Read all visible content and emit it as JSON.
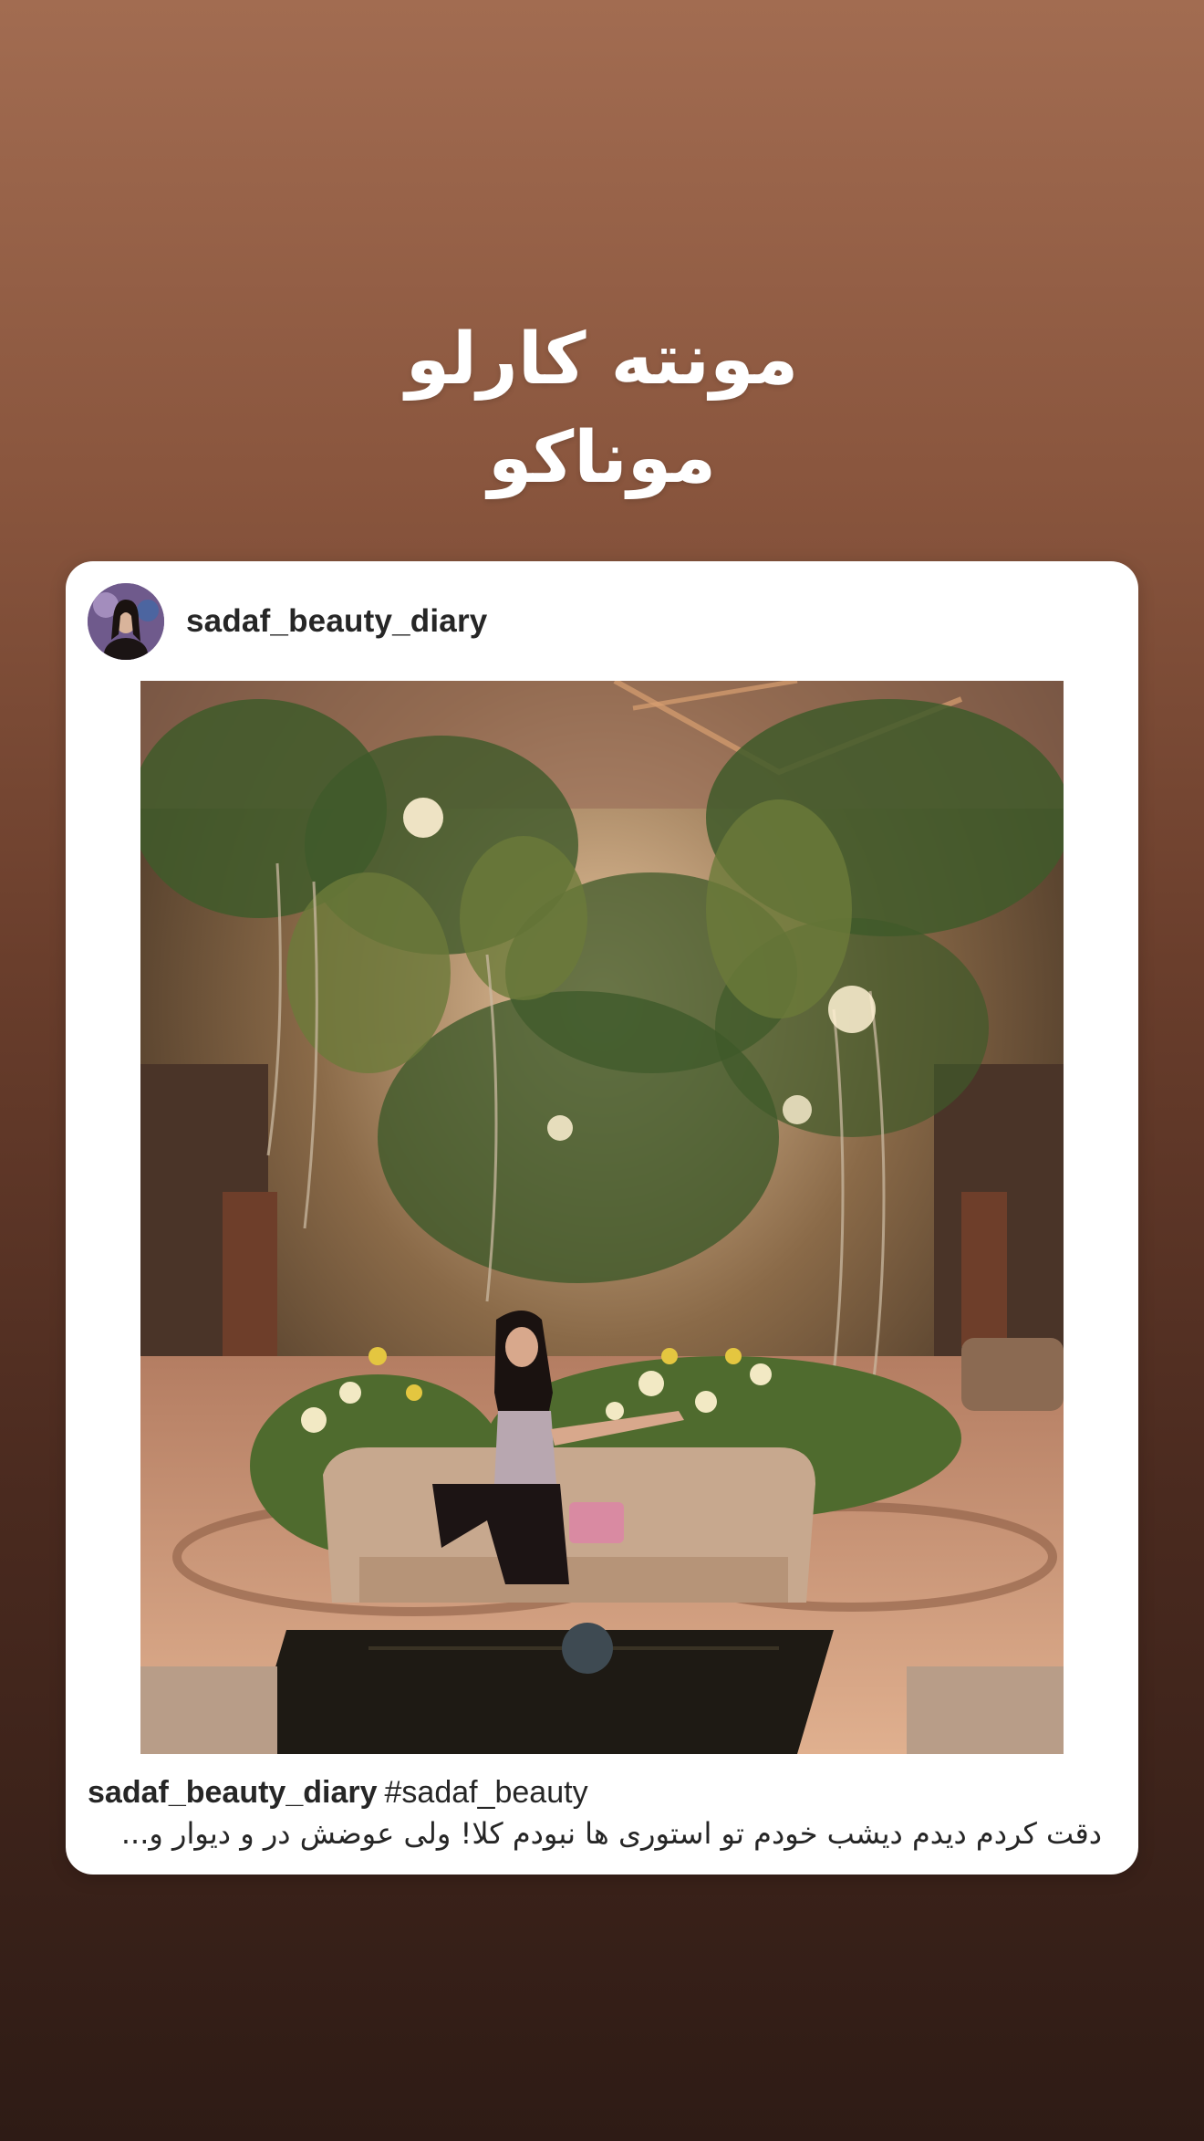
{
  "story": {
    "title_line1": "مونته کارلو",
    "title_line2": "موناکو"
  },
  "post": {
    "username": "sadaf_beauty_diary",
    "caption_username": "sadaf_beauty_diary",
    "caption_hashtag": "#sadaf_beauty",
    "caption_text": "دقت کردم دیدم دیشب خودم تو استوری ها نبودم کلا! ولی عوضش در و دیوار و...",
    "photo_subject": "woman-on-sofa-in-garden-lobby"
  },
  "colors": {
    "background_top": "#a26c51",
    "background_bottom": "#2e1b15",
    "card": "#ffffff",
    "text": "#262626"
  }
}
